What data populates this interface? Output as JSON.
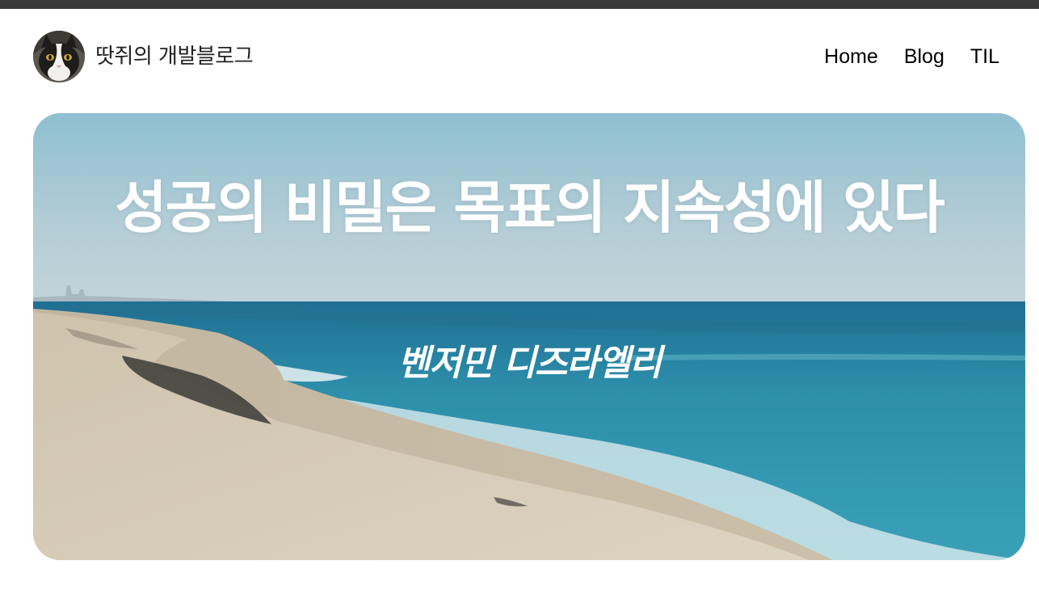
{
  "header": {
    "blog_title": "땃쥐의 개발블로그",
    "avatar_icon": "cat-avatar-icon",
    "nav": [
      {
        "label": "Home"
      },
      {
        "label": "Blog"
      },
      {
        "label": "TIL"
      }
    ]
  },
  "hero": {
    "quote": "성공의 비밀은 목표의 지속성에 있다",
    "author": "벤저민 디즈라엘리",
    "background": "beach-ocean-photo"
  },
  "colors": {
    "top_bar": "#3b3b3b",
    "text_dark": "#222222",
    "nav_text": "#000000",
    "hero_text": "#ffffff",
    "sky": "#9cc6d3",
    "ocean": "#2a8aa8",
    "sand": "#d4c8b3"
  }
}
